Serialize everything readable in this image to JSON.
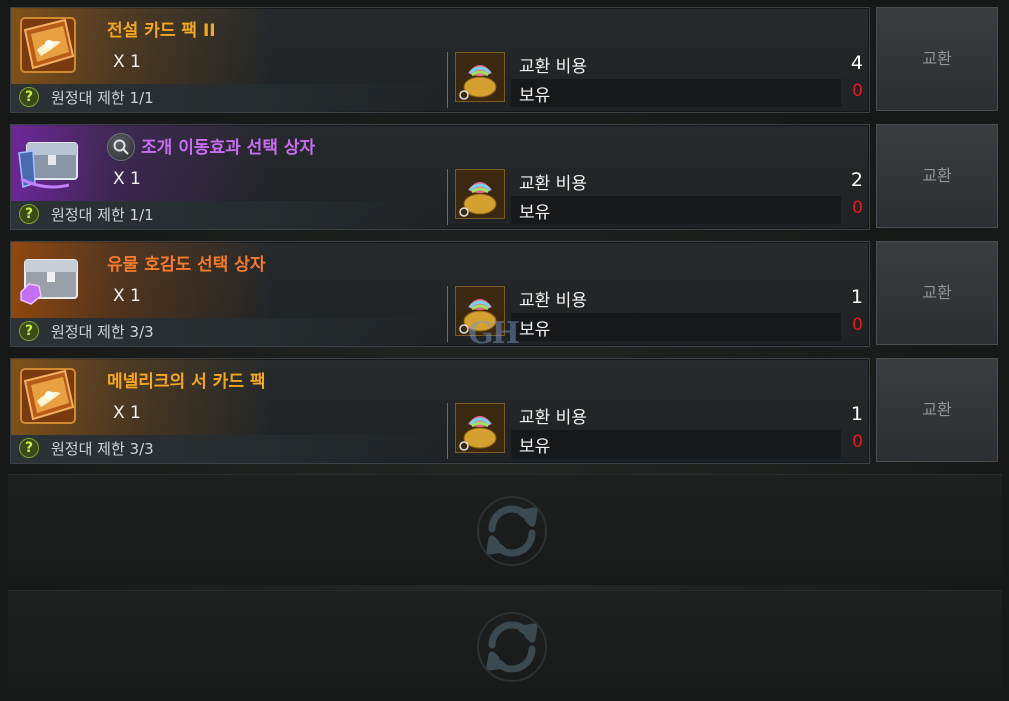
{
  "offers": [
    {
      "name": "전설 카드 팩 II",
      "name_color": "orange",
      "quantity": "X 1",
      "limit": "원정대 제한 1/1",
      "cost_label": "교환 비용",
      "cost": "4",
      "own_label": "보유",
      "own": "0",
      "exchange_label": "교환",
      "icon": "card-pack-book-icon"
    },
    {
      "name": "조개 이동효과 선택 상자",
      "name_color": "purple",
      "quantity": "X 1",
      "limit": "원정대 제한 1/1",
      "cost_label": "교환 비용",
      "cost": "2",
      "own_label": "보유",
      "own": "0",
      "exchange_label": "교환",
      "icon": "treasure-chest-boots-icon"
    },
    {
      "name": "유물 호감도 선택 상자",
      "name_color": "redorange",
      "quantity": "X 1",
      "limit": "원정대 제한 3/3",
      "cost_label": "교환 비용",
      "cost": "1",
      "own_label": "보유",
      "own": "0",
      "exchange_label": "교환",
      "icon": "treasure-chest-gem-icon"
    },
    {
      "name": "메넬리크의 서 카드 팩",
      "name_color": "orange",
      "quantity": "X 1",
      "limit": "원정대 제한 3/3",
      "cost_label": "교환 비용",
      "cost": "1",
      "own_label": "보유",
      "own": "0",
      "exchange_label": "교환",
      "icon": "card-pack-book-icon"
    }
  ],
  "currency_icon": "rainbow-shell-pouch-icon",
  "empty_slot_icon": "refresh-icon",
  "watermark": "GH",
  "colors": {
    "orange": "#f5a623",
    "purple": "#c86cf0",
    "redorange": "#f47a2c",
    "own_zero": "#e81818",
    "help": "#c8f04a"
  }
}
